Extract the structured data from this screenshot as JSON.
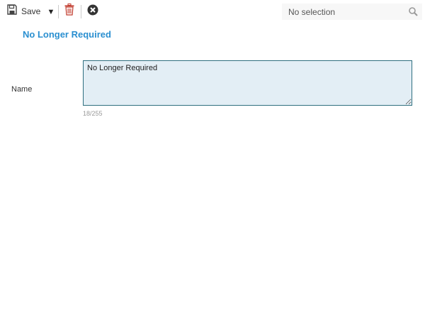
{
  "toolbar": {
    "save_label": "Save",
    "save_icon": "floppy-disk-icon",
    "dropdown_glyph": "▼",
    "delete_icon": "trash-icon",
    "cancel_icon": "circle-x-icon",
    "search": {
      "value": "No selection",
      "icon": "search-icon"
    }
  },
  "record": {
    "title": "No Longer Required"
  },
  "form": {
    "name": {
      "label": "Name",
      "value": "No Longer Required",
      "char_count": "18/255"
    }
  },
  "colors": {
    "accent": "#2a8fd0",
    "field_background": "#e3eef5",
    "field_border": "#2f6f7f",
    "delete_icon": "#c0392b"
  }
}
